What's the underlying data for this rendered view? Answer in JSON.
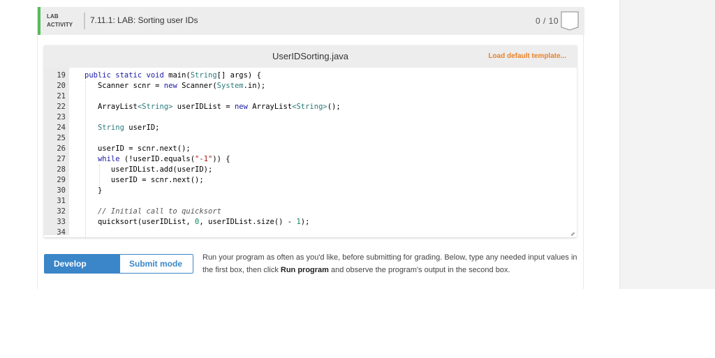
{
  "header": {
    "lab_label_line1": "LAB",
    "lab_label_line2": "ACTIVITY",
    "title": "7.11.1: LAB: Sorting user IDs",
    "score": "0 / 10",
    "badge_icon": "score-badge-icon"
  },
  "editor": {
    "filename": "UserIDSorting.java",
    "load_template_label": "Load default template...",
    "lines": [
      {
        "n": "19",
        "html": "<span class=\"kw\">public static void</span> main(<span class=\"ty\">String</span>[] args) {"
      },
      {
        "n": "20",
        "html": "   Scanner scnr = <span class=\"kw\">new</span> Scanner(<span class=\"ty\">System</span>.in);"
      },
      {
        "n": "21",
        "html": ""
      },
      {
        "n": "22",
        "html": "   ArrayList<span class=\"ty\">&lt;String&gt;</span> userIDList = <span class=\"kw\">new</span> ArrayList<span class=\"ty\">&lt;String&gt;</span>();"
      },
      {
        "n": "23",
        "html": ""
      },
      {
        "n": "24",
        "html": "   <span class=\"ty\">String</span> userID;"
      },
      {
        "n": "25",
        "html": ""
      },
      {
        "n": "26",
        "html": "   userID = scnr.next();"
      },
      {
        "n": "27",
        "html": "   <span class=\"kw\">while</span> (!userID.equals(<span class=\"str\">\"-1\"</span>)) {"
      },
      {
        "n": "28",
        "html": "      userIDList.add(userID);"
      },
      {
        "n": "29",
        "html": "      userID = scnr.next();"
      },
      {
        "n": "30",
        "html": "   }"
      },
      {
        "n": "31",
        "html": ""
      },
      {
        "n": "32",
        "html": "   <span class=\"cm\">// Initial call to quicksort</span>"
      },
      {
        "n": "33",
        "html": "   quicksort(userIDList, <span class=\"num\">0</span>, userIDList.size() - <span class=\"num\">1</span>);"
      },
      {
        "n": "34",
        "html": ""
      }
    ]
  },
  "modes": {
    "develop_label": "Develop mode",
    "submit_label": "Submit mode",
    "active": "develop"
  },
  "instructions": {
    "part1": "Run your program as often as you'd like, before submitting for grading. Below, type any needed input values in the first box, then click ",
    "bold": "Run program",
    "part2": " and observe the program's output in the second box."
  },
  "colors": {
    "accent_green": "#5cb85c",
    "mode_blue": "#3b86c8",
    "template_orange": "#e8822a"
  }
}
